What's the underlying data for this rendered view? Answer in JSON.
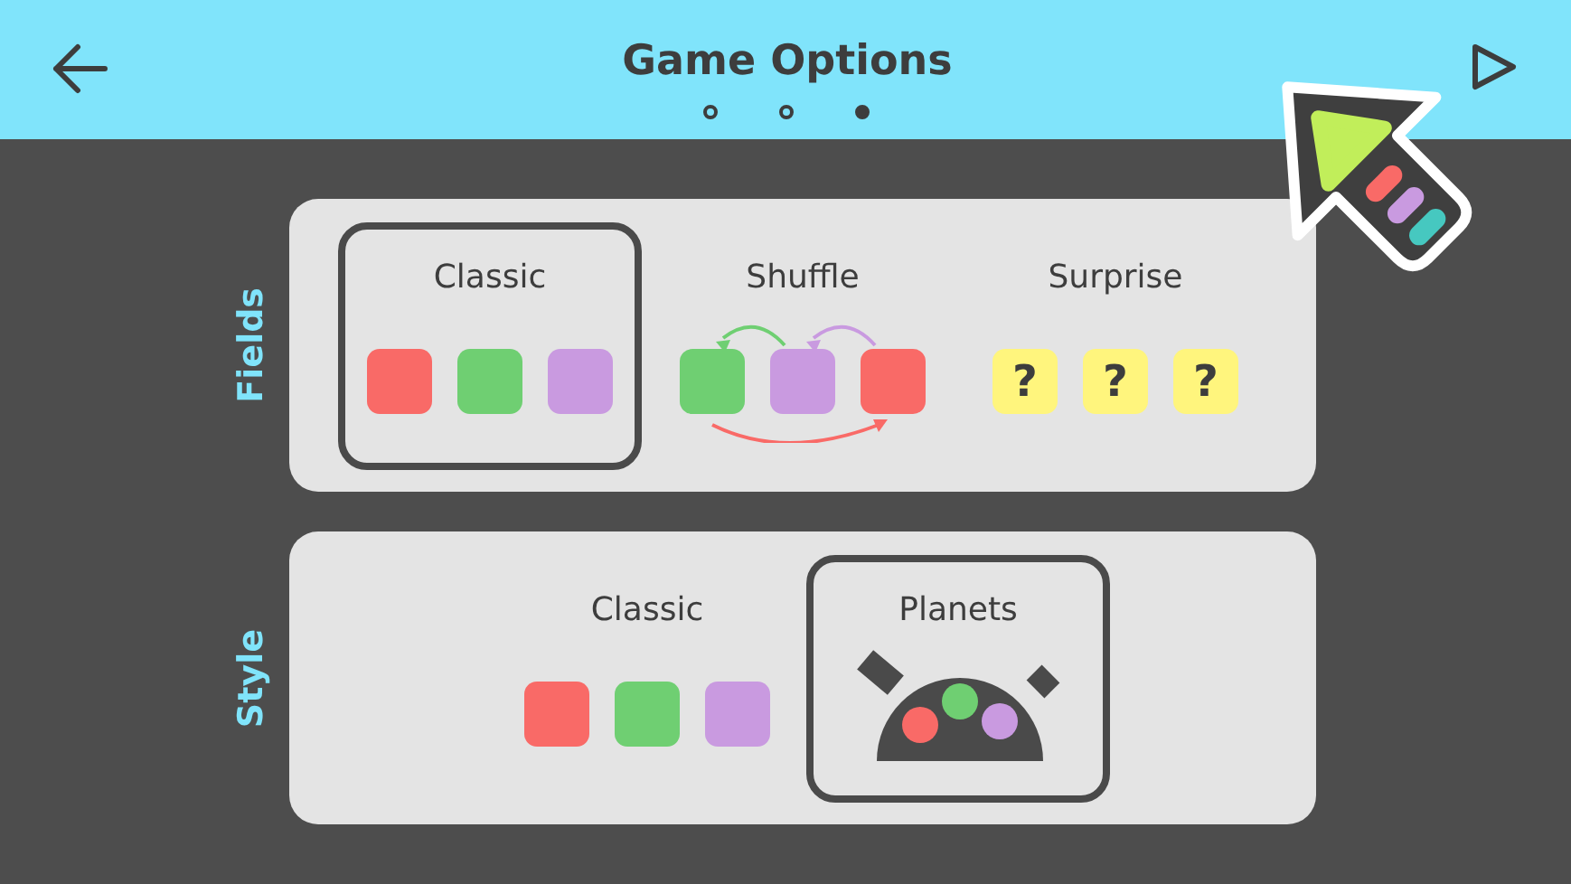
{
  "header": {
    "title": "Game Options",
    "pages": [
      {
        "selected": false
      },
      {
        "selected": false
      },
      {
        "selected": true
      }
    ]
  },
  "sections": [
    {
      "label": "Fields",
      "options": [
        {
          "label": "Classic",
          "kind": "classic",
          "selected": true
        },
        {
          "label": "Shuffle",
          "kind": "shuffle",
          "selected": false
        },
        {
          "label": "Surprise",
          "kind": "surprise",
          "selected": false,
          "marks": [
            "?",
            "?",
            "?"
          ]
        }
      ]
    },
    {
      "label": "Style",
      "options": [
        {
          "label": "Classic",
          "kind": "classic",
          "selected": false
        },
        {
          "label": "Planets",
          "kind": "planets",
          "selected": true
        }
      ]
    }
  ]
}
